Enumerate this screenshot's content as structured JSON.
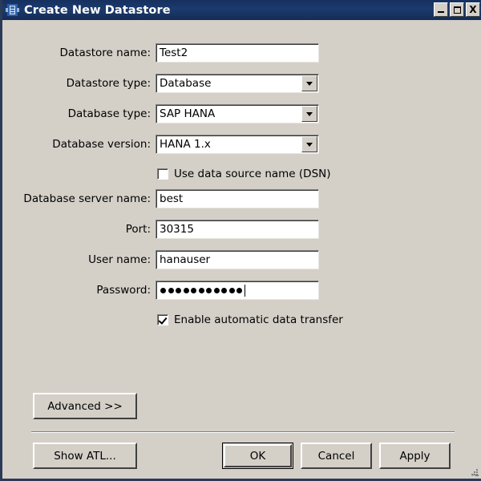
{
  "window": {
    "title": "Create New Datastore",
    "icon": "datastore-icon",
    "titlebar_color": "#16305e",
    "background_color": "#d4d0c8",
    "controls": {
      "minimize": "_",
      "maximize": "□",
      "close": "X"
    }
  },
  "form": {
    "fields": [
      {
        "label": "Datastore name:",
        "value": "Test2",
        "type": "text"
      },
      {
        "label": "Datastore type:",
        "value": "Database",
        "type": "combo"
      },
      {
        "label": "Database type:",
        "value": "SAP HANA",
        "type": "combo"
      },
      {
        "label": "Database version:",
        "value": "HANA 1.x",
        "type": "combo"
      },
      {
        "label": "Database server name:",
        "value": "best",
        "type": "text"
      },
      {
        "label": "Port:",
        "value": "30315",
        "type": "text"
      },
      {
        "label": "User name:",
        "value": "hanauser",
        "type": "text"
      },
      {
        "label": "Password:",
        "value": "●●●●●●●●●●●",
        "type": "password",
        "masked_length": 11
      }
    ],
    "checkboxes": [
      {
        "label": "Use data source name (DSN)",
        "checked": false
      },
      {
        "label": "Enable automatic data transfer",
        "checked": true
      }
    ]
  },
  "buttons": {
    "advanced": "Advanced >>",
    "show_atl": "Show ATL...",
    "ok": "OK",
    "cancel": "Cancel",
    "apply": "Apply",
    "default_button": "OK"
  }
}
